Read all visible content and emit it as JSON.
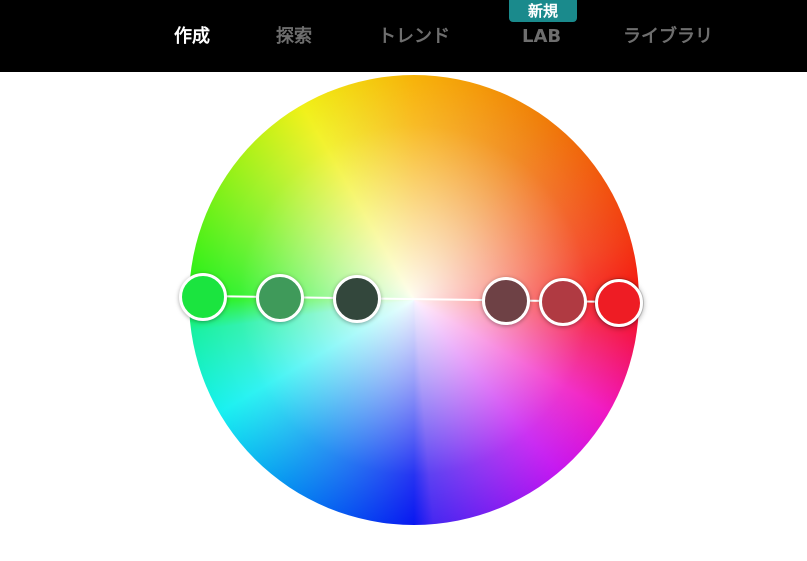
{
  "nav": {
    "items": [
      {
        "label": "作成",
        "active": true
      },
      {
        "label": "探索",
        "active": false
      },
      {
        "label": "トレンド",
        "active": false
      },
      {
        "label": "LAB",
        "active": false
      },
      {
        "label": "ライブラリ",
        "active": false
      }
    ],
    "badge": "新規"
  },
  "colors": {
    "topbar": "#000000",
    "badge": "#1a8a8c",
    "nav_active": "#ffffff",
    "nav_inactive": "#6e6e6e"
  },
  "color_wheel": {
    "swatches": [
      {
        "color": "#1be43f"
      },
      {
        "color": "#3f9a5a"
      },
      {
        "color": "#33473c"
      },
      {
        "color": "#6e4145"
      },
      {
        "color": "#b03a42"
      },
      {
        "color": "#ee1c24",
        "base": true
      }
    ]
  }
}
